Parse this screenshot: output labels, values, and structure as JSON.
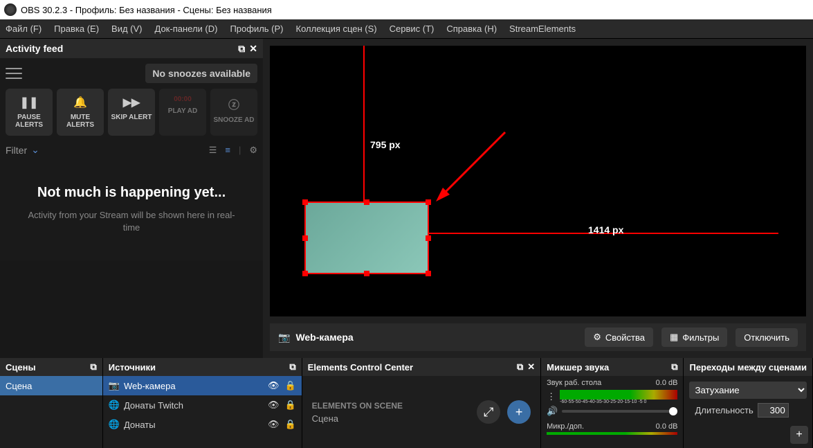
{
  "title": "OBS 30.2.3 - Профиль: Без названия - Сцены: Без названия",
  "menu": [
    "Файл (F)",
    "Правка (E)",
    "Вид (V)",
    "Док-панели (D)",
    "Профиль (P)",
    "Коллекция сцен (S)",
    "Сервис (T)",
    "Справка (H)",
    "StreamElements"
  ],
  "activity": {
    "header": "Activity feed",
    "snooze": "No snoozes available",
    "buttons": {
      "pause": "PAUSE ALERTS",
      "mute": "MUTE ALERTS",
      "skip": "SKIP ALERT",
      "play": "PLAY AD",
      "play_timer": "00:00",
      "snoozeAd": "SNOOZE AD"
    },
    "filter": "Filter",
    "empty_title": "Not much is happening yet...",
    "empty_sub": "Activity from your Stream will be shown here in real-time"
  },
  "preview": {
    "vlabel": "795 px",
    "hlabel": "1414 px",
    "source_name": "Web-камера",
    "btn_props": "Свойства",
    "btn_filters": "Фильтры",
    "btn_disable": "Отключить"
  },
  "scenes": {
    "header": "Сцены",
    "items": [
      "Сцена"
    ]
  },
  "sources": {
    "header": "Источники",
    "items": [
      {
        "label": "Web-камера",
        "icon": "camera"
      },
      {
        "label": "Донаты Twitch",
        "icon": "globe"
      },
      {
        "label": "Донаты",
        "icon": "globe"
      }
    ]
  },
  "elements": {
    "header": "Elements Control Center",
    "title": "ELEMENTS ON SCENE",
    "scene": "Сцена"
  },
  "mixer": {
    "header": "Микшер звука",
    "ch1": {
      "label": "Звук раб. стола",
      "db": "0.0 dB"
    },
    "ch2": {
      "label": "Микр./доп.",
      "db": "0.0 dB"
    },
    "ticks": "-60-55-50-45-40-35-30-25-20-15-10 -5  0"
  },
  "transitions": {
    "header": "Переходы между сценами",
    "mode": "Затухание",
    "duration_label": "Длительность",
    "duration": "300"
  }
}
